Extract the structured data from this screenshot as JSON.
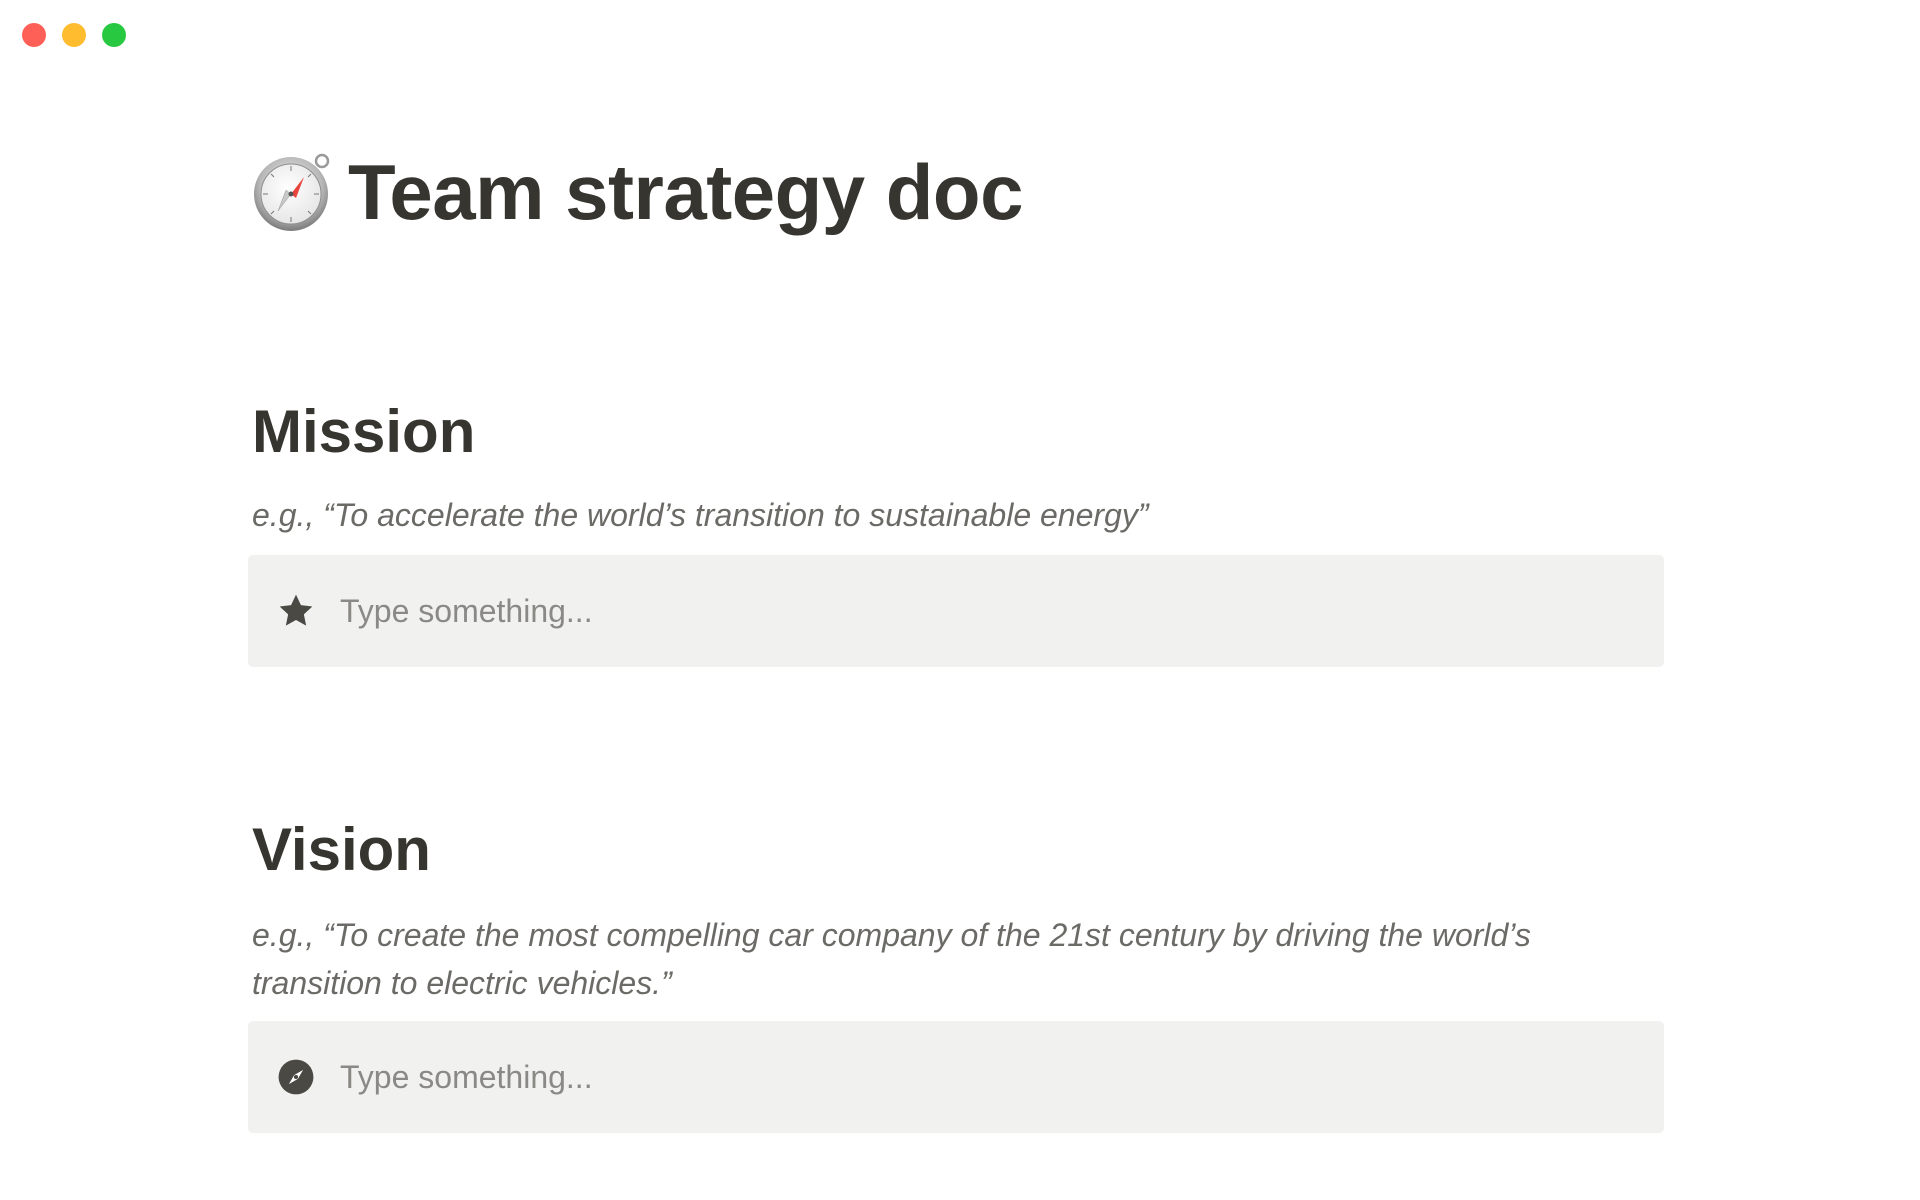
{
  "window": {
    "controls": [
      "close",
      "minimize",
      "maximize"
    ],
    "colors": {
      "close": "#fe5f57",
      "minimize": "#febc2e",
      "maximize": "#28c840"
    }
  },
  "page": {
    "icon": "compass-icon",
    "title": "Team strategy doc"
  },
  "sections": [
    {
      "heading": "Mission",
      "hint": "e.g., “To accelerate the world’s transition to sustainable energy”",
      "callout": {
        "icon": "star-icon",
        "placeholder": "Type something..."
      }
    },
    {
      "heading": "Vision",
      "hint": "e.g., “To create the most compelling car company of the 21st century by driving the world’s transition to electric vehicles.”",
      "callout": {
        "icon": "compass-circle-icon",
        "placeholder": "Type something..."
      }
    }
  ],
  "colors": {
    "text": "#37352f",
    "hint": "#6b6a66",
    "callout_bg": "#f1f1ef",
    "placeholder": "#8a8985",
    "compass_needle": "#e8453c"
  }
}
